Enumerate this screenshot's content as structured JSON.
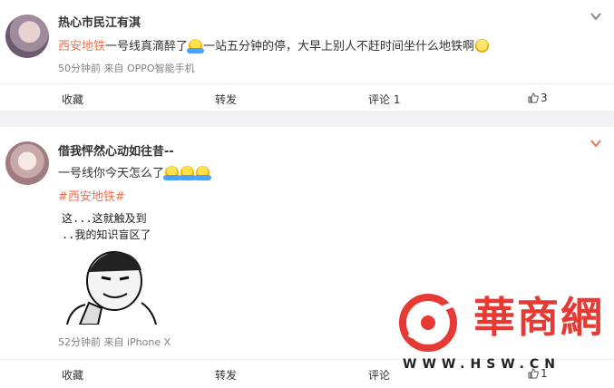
{
  "posts": [
    {
      "name": "热心市民江有淇",
      "link": "西安地铁",
      "text_a": "一号线真滴醉了",
      "text_b": "一站五分钟的停，大早上别人不赶时间坐什么地铁啊",
      "meta": "50分钟前 来自 OPPO智能手机",
      "actions": {
        "collect": "收藏",
        "repost": "转发",
        "comment": "评论 1",
        "like_count": "3"
      }
    },
    {
      "name": "借我怦然心动如往昔--",
      "text": "一号线你今天怎么了",
      "topic": "#西安地铁#",
      "image_caption_1": "这...这就触及到",
      "image_caption_2": "..我的知识盲区了",
      "meta": "52分钟前 来自 iPhone X",
      "actions": {
        "collect": "收藏",
        "repost": "转发",
        "comment": "评论",
        "like_count": "1"
      }
    }
  ],
  "watermark": {
    "brand": "華商網",
    "url": "WWW.HSW.CN",
    "color": "#e63a34"
  },
  "icons": {
    "chevron": "chevron-down-icon",
    "like": "thumbs-up-icon",
    "emoji_hug": "hug-emoji-icon",
    "emoji_smile": "smile-emoji-icon"
  }
}
